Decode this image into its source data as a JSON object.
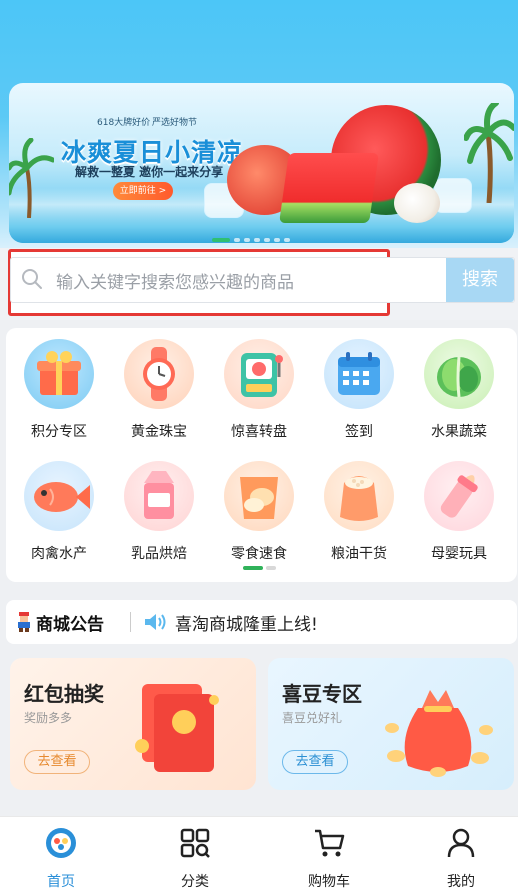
{
  "banner": {
    "tag_left": "618大牌好价",
    "tag_right": "严选好物节",
    "title": "冰爽夏日小清凉",
    "subtitle": "解救一整夏 邀你一起来分享",
    "button_label": "立即前往 >"
  },
  "search": {
    "placeholder": "输入关键字搜索您感兴趣的商品",
    "button_label": "搜索"
  },
  "categories": [
    {
      "label": "积分专区",
      "icon": "gift-box-icon"
    },
    {
      "label": "黄金珠宝",
      "icon": "watch-icon"
    },
    {
      "label": "惊喜转盘",
      "icon": "slot-machine-icon"
    },
    {
      "label": "签到",
      "icon": "calendar-icon"
    },
    {
      "label": "水果蔬菜",
      "icon": "cabbage-icon"
    },
    {
      "label": "肉禽水产",
      "icon": "fish-icon"
    },
    {
      "label": "乳品烘焙",
      "icon": "milk-carton-icon"
    },
    {
      "label": "零食速食",
      "icon": "snack-bag-icon"
    },
    {
      "label": "粮油干货",
      "icon": "rice-sack-icon"
    },
    {
      "label": "母婴玩具",
      "icon": "baby-bottle-icon"
    }
  ],
  "notice": {
    "title": "商城公告",
    "text": "喜淘商城隆重上线!"
  },
  "promos": [
    {
      "title": "红包抽奖",
      "subtitle": "奖励多多",
      "button": "去查看",
      "icon": "red-envelope-icon"
    },
    {
      "title": "喜豆专区",
      "subtitle": "喜豆兑好礼",
      "button": "去查看",
      "icon": "lucky-bag-icon"
    }
  ],
  "tabs": [
    {
      "label": "首页",
      "icon": "home-icon",
      "active": true
    },
    {
      "label": "分类",
      "icon": "category-grid-icon",
      "active": false
    },
    {
      "label": "购物车",
      "icon": "cart-icon",
      "active": false
    },
    {
      "label": "我的",
      "icon": "user-icon",
      "active": false
    }
  ],
  "colors": {
    "accent": "#2a8fd8",
    "search_highlight": "#e53935",
    "search_button": "#a8d8f4",
    "pager_active": "#30b25a"
  }
}
